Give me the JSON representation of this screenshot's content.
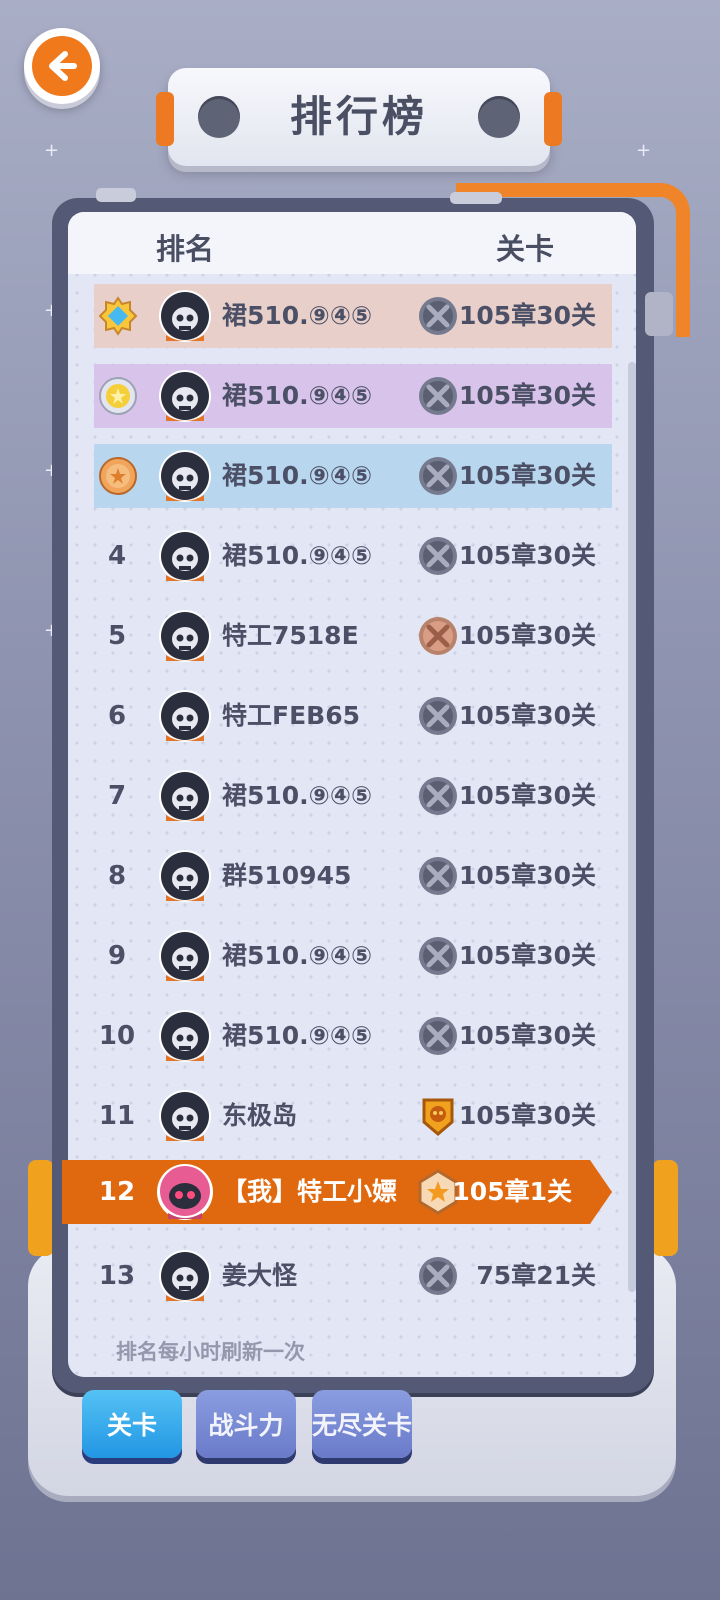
{
  "header": {
    "title": "排行榜"
  },
  "table_header": {
    "rank": "排名",
    "level": "关卡"
  },
  "rows": [
    {
      "rank": "",
      "medal": "diamond-medal",
      "name": "裙510.⑨④⑤",
      "badge": "skull-badge",
      "level": "105章30关",
      "highlight": "#e8cfc9"
    },
    {
      "rank": "",
      "medal": "gold-medal",
      "name": "裙510.⑨④⑤",
      "badge": "skull-badge",
      "level": "105章30关",
      "highlight": "#d8c3ea"
    },
    {
      "rank": "",
      "medal": "bronze-medal",
      "name": "裙510.⑨④⑤",
      "badge": "skull-badge",
      "level": "105章30关",
      "highlight": "#b9d6ef"
    },
    {
      "rank": "4",
      "name": "裙510.⑨④⑤",
      "badge": "skull-badge",
      "level": "105章30关"
    },
    {
      "rank": "5",
      "name": "特工7518E",
      "badge": "bronze-skull-badge",
      "level": "105章30关"
    },
    {
      "rank": "6",
      "name": "特工FEB65",
      "badge": "skull-badge",
      "level": "105章30关"
    },
    {
      "rank": "7",
      "name": "裙510.⑨④⑤",
      "badge": "skull-badge",
      "level": "105章30关"
    },
    {
      "rank": "8",
      "name": "群510945",
      "badge": "skull-badge",
      "level": "105章30关"
    },
    {
      "rank": "9",
      "name": "裙510.⑨④⑤",
      "badge": "skull-badge",
      "level": "105章30关"
    },
    {
      "rank": "10",
      "name": "裙510.⑨④⑤",
      "badge": "skull-badge",
      "level": "105章30关"
    },
    {
      "rank": "11",
      "name": "东极岛",
      "badge": "gold-shield-badge",
      "level": "105章30关"
    },
    {
      "rank": "13",
      "name": "姜大怪",
      "badge": "skull-badge",
      "level": "75章21关"
    }
  ],
  "my_row": {
    "rank": "12",
    "name": "【我】特工小嫖",
    "badge": "gold-star-badge",
    "level": "105章1关"
  },
  "footnote": "排名每小时刷新一次",
  "tabs": [
    {
      "label": "关卡",
      "active": true
    },
    {
      "label": "战斗力",
      "active": false
    },
    {
      "label": "无尽关卡",
      "active": false
    }
  ],
  "colors": {
    "accent": "#e0690f",
    "panel": "#545a75",
    "active_tab": "#2196e3"
  }
}
